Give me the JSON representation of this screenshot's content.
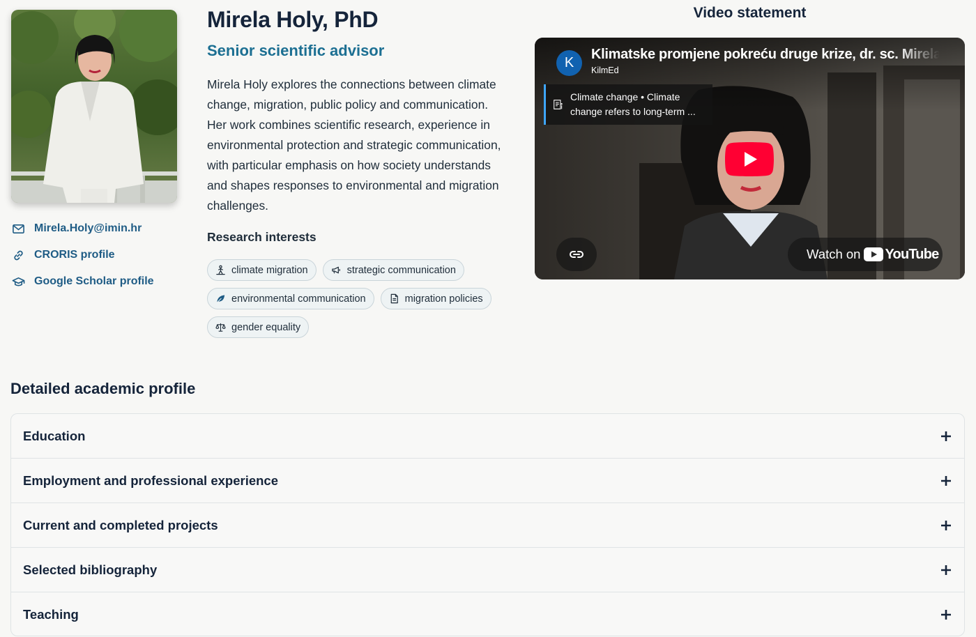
{
  "profile": {
    "name": "Mirela Holy, PhD",
    "role": "Senior scientific advisor",
    "bio": "Mirela Holy explores the connections between climate change, migration, public policy and communication. Her work combines scientific research, experience in environmental protection and strategic communication, with particular emphasis on how society understands and shapes responses to environmental and migration challenges."
  },
  "contacts": [
    {
      "label": "Mirela.Holy@imin.hr",
      "icon": "mail-icon"
    },
    {
      "label": "CRORIS profile",
      "icon": "link-icon"
    },
    {
      "label": "Google Scholar profile",
      "icon": "graduation-cap-icon"
    }
  ],
  "interests": {
    "title": "Research interests",
    "tags": [
      {
        "label": "climate migration",
        "icon": "people-walking-icon"
      },
      {
        "label": "strategic communication",
        "icon": "megaphone-icon"
      },
      {
        "label": "environmental communication",
        "icon": "leaf-icon"
      },
      {
        "label": "migration policies",
        "icon": "document-icon"
      },
      {
        "label": "gender equality",
        "icon": "scales-icon"
      }
    ]
  },
  "video": {
    "heading": "Video statement",
    "title": "Klimatske promjene pokreću druge krize, dr. sc. Mirela Holy",
    "channel_initial": "K",
    "channel_name": "KilmEd",
    "info_card": "Climate change • Climate change refers to long-term ...",
    "watch_on": "Watch on",
    "youtube": "YouTube",
    "colors": {
      "play": "#ff0033",
      "avatar": "#1162b0",
      "info_border": "#3ea6ff"
    }
  },
  "academic": {
    "title": "Detailed academic profile",
    "sections": [
      {
        "label": "Education"
      },
      {
        "label": "Employment and professional experience"
      },
      {
        "label": "Current and completed projects"
      },
      {
        "label": "Selected bibliography"
      },
      {
        "label": "Teaching"
      }
    ]
  },
  "colors": {
    "link": "#1f5c85",
    "role": "#1c6f92",
    "heading": "#15243a",
    "background": "#f7f7f5"
  }
}
